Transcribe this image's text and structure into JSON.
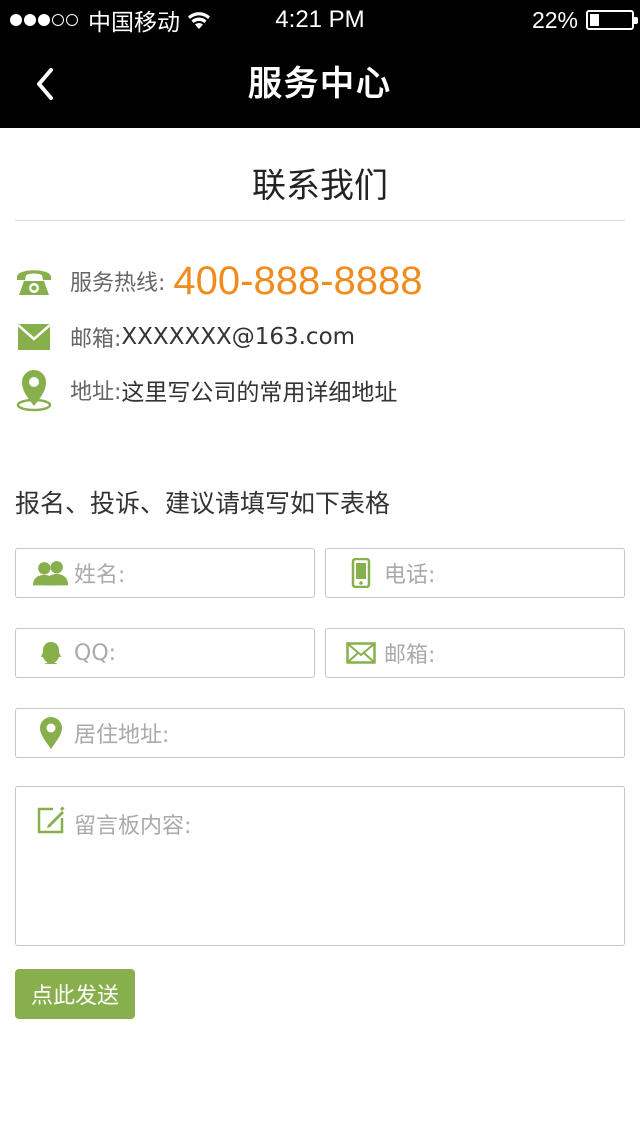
{
  "status_bar": {
    "carrier": "中国移动",
    "time": "4:21 PM",
    "battery_percent": "22%",
    "battery_level": 0.22,
    "signal_bars_filled": 3,
    "signal_bars_total": 5
  },
  "nav": {
    "title": "服务中心",
    "back_icon": "chevron-left-icon"
  },
  "contact": {
    "title": "联系我们",
    "hotline_label": "服务热线:",
    "hotline_value": "400-888-8888",
    "email_label": "邮箱:",
    "email_value": "XXXXXXX@163.com",
    "address_label": "地址:",
    "address_value": "这里写公司的常用详细地址"
  },
  "form": {
    "heading": "报名、投诉、建议请填写如下表格",
    "name_placeholder": "姓名:",
    "phone_placeholder": "电话:",
    "qq_placeholder": "QQ:",
    "email_placeholder": "邮箱:",
    "address_placeholder": "居住地址:",
    "message_placeholder": "留言板内容:",
    "submit_label": "点此发送"
  },
  "colors": {
    "accent_green": "#87b04c",
    "hotline_orange": "#f08c1e",
    "bar_black": "#000000"
  }
}
